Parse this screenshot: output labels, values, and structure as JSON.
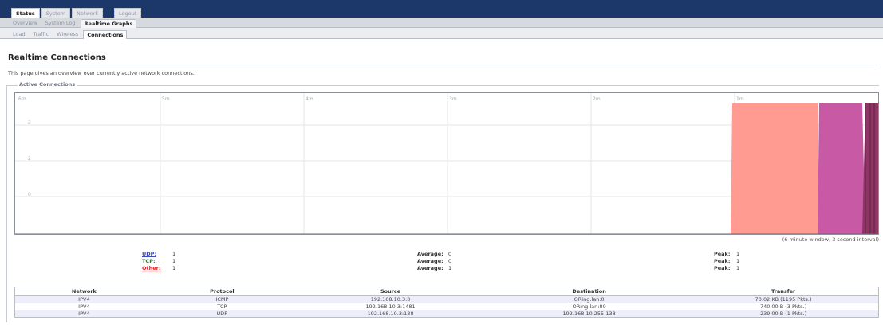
{
  "nav": {
    "main_tabs": [
      "Status",
      "System",
      "Network",
      "Logout"
    ],
    "status_tabs": [
      "Overview",
      "System Log",
      "Realtime Graphs"
    ],
    "graph_tabs": [
      "Load",
      "Traffic",
      "Wireless",
      "Connections"
    ]
  },
  "page": {
    "title": "Realtime Connections",
    "description": "This page gives an overview over currently active network connections.",
    "section_legend": "Active Connections",
    "window_note": "(6 minute window, 3 second interval)"
  },
  "graph": {
    "time_labels": [
      "6m",
      "5m",
      "4m",
      "3m",
      "2m",
      "1m"
    ],
    "y_labels": [
      "3",
      "2",
      "0"
    ],
    "colors": {
      "udp": "#ff9b91",
      "tcp": "#c85aa5",
      "other": "#8e3564",
      "grid": "#e6e6e6"
    },
    "series_levels": {
      "udp": 1,
      "tcp": 1,
      "other": 1
    }
  },
  "stats": [
    {
      "label": "UDP:",
      "value": "1",
      "avg_label": "Average:",
      "avg": "0",
      "peak_label": "Peak:",
      "peak": "1",
      "color": "#3b4bbd"
    },
    {
      "label": "TCP:",
      "value": "1",
      "avg_label": "Average:",
      "avg": "0",
      "peak_label": "Peak:",
      "peak": "1",
      "color": "#2f7a3a"
    },
    {
      "label": "Other:",
      "value": "1",
      "avg_label": "Average:",
      "avg": "1",
      "peak_label": "Peak:",
      "peak": "1",
      "color": "#d7262a"
    }
  ],
  "table": {
    "headers": [
      "Network",
      "Protocol",
      "Source",
      "Destination",
      "Transfer"
    ],
    "rows": [
      [
        "IPV4",
        "ICMP",
        "192.168.10.3:0",
        "ORing.lan:0",
        "70.02 KB (1195 Pkts.)"
      ],
      [
        "IPV4",
        "TCP",
        "192.168.10.3:1481",
        "ORing.lan:80",
        "740.00 B (3 Pkts.)"
      ],
      [
        "IPV4",
        "UDP",
        "192.168.10.3:138",
        "192.168.10.255:138",
        "239.00 B (1 Pkts.)"
      ]
    ]
  }
}
